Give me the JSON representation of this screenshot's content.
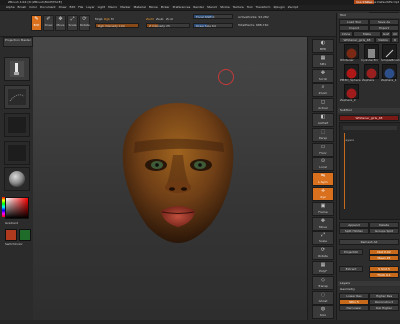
{
  "app": {
    "title": "ZBrush 4.R4  [D:\\ZBrush\\FACE\\FACE]",
    "quicksave": "QuickSave",
    "menus_label": "Menus",
    "default_script": "DefaultZScript"
  },
  "menu_bar": [
    "Alpha",
    "Brush",
    "Color",
    "Document",
    "Draw",
    "Edit",
    "File",
    "Layer",
    "Light",
    "Macro",
    "Marker",
    "Material",
    "Movie",
    "Picker",
    "Preferences",
    "Render",
    "Stencil",
    "Stroke",
    "Texture",
    "Tool",
    "Transform",
    "Zplugin",
    "Zscript"
  ],
  "shelf": {
    "tools": [
      {
        "label": "Edit",
        "icon": "pencil-icon",
        "glyph": "✎"
      },
      {
        "label": "Draw",
        "icon": "brush-icon",
        "glyph": "✐"
      },
      {
        "label": "Move",
        "icon": "move-icon",
        "glyph": "✥"
      },
      {
        "label": "Scale",
        "icon": "scale-icon",
        "glyph": "⤢"
      },
      {
        "label": "Rotate",
        "icon": "rotate-icon",
        "glyph": "⟳"
      }
    ],
    "modes": {
      "mrgb": "Mrgb",
      "rgb": "Rgb",
      "m": "M",
      "zadd": "Zadd",
      "zsub": "Zsub",
      "zcut": "Zcut"
    },
    "sliders": {
      "rgb_intensity": {
        "label": "Rgb Intensity",
        "value": 100,
        "fraction": 1.0
      },
      "z_intensity": {
        "label": "Z Intensity",
        "value": 25,
        "fraction": 0.25
      },
      "focal_shift": {
        "label": "Focal Shift",
        "value": 0,
        "fraction": 0.5
      },
      "draw_size": {
        "label": "Draw Size",
        "value": 64,
        "fraction": 0.35
      }
    },
    "stats": {
      "active_points": "ActivePoints: 93,282",
      "total_points": "TotalPoints: 688,740"
    },
    "lightbox": "Light Box"
  },
  "left_shelf": {
    "projection_master": "Projection Master",
    "gradient_label": "Gradient",
    "switch_color_label": "SwitchColor",
    "colors": {
      "main": "#b03a1e",
      "secondary": "#1f6b2a",
      "secondary_b": "#c87a18"
    }
  },
  "right_toolbar": [
    {
      "label": "BPR",
      "icon": "bpr-icon",
      "glyph": "◐"
    },
    {
      "label": "SPix",
      "icon": "spix-icon",
      "glyph": "▦"
    },
    {
      "label": "Scroll",
      "icon": "scroll-icon",
      "glyph": "✥"
    },
    {
      "label": "Zoom",
      "icon": "zoom-icon",
      "glyph": "⌕"
    },
    {
      "label": "Actual",
      "icon": "actual-icon",
      "glyph": "◻"
    },
    {
      "label": "AAHalf",
      "icon": "aahalf-icon",
      "glyph": "◧"
    },
    {
      "label": "Persp",
      "icon": "persp-icon",
      "glyph": "⬚"
    },
    {
      "label": "Floor",
      "icon": "floor-icon",
      "glyph": "▭"
    },
    {
      "label": "Local",
      "icon": "local-icon",
      "glyph": "⊙"
    },
    {
      "label": "L.Sym",
      "icon": "lsym-icon",
      "glyph": "⇋"
    },
    {
      "label": "Xyz",
      "icon": "xyz-icon",
      "glyph": "✛"
    },
    {
      "label": "Frame",
      "icon": "frame-icon",
      "glyph": "▣"
    },
    {
      "label": "Move",
      "icon": "move-view-icon",
      "glyph": "✥"
    },
    {
      "label": "Scale",
      "icon": "scale-view-icon",
      "glyph": "⤢"
    },
    {
      "label": "Rotate",
      "icon": "rotate-view-icon",
      "glyph": "⟳"
    },
    {
      "label": "PolyF",
      "icon": "polyframe-icon",
      "glyph": "▦"
    },
    {
      "label": "Transp",
      "icon": "transp-icon",
      "glyph": "◇"
    },
    {
      "label": "Ghost",
      "icon": "ghost-icon",
      "glyph": "◌"
    },
    {
      "label": "Solo",
      "icon": "solo-icon",
      "glyph": "◍"
    }
  ],
  "palette": {
    "header": "Tool",
    "load_tool": "Load Tool",
    "save_as": "Save As",
    "import": "Import",
    "export": "Export",
    "clone": "Clone",
    "make_polymesh": "Make PolyMesh3D",
    "goz": "GoZ",
    "all": "All",
    "visible": "Visible",
    "r": "R",
    "current_tool": "Whitener_girls_48",
    "thumbs": [
      "Whitener",
      "Cylinder3D",
      "SimpleBrush",
      "PM3D_Sphere",
      "Zsphere",
      "Zsphere_1",
      "Zsphere_2"
    ],
    "subtool_head": "SubTool",
    "subtools": [
      "Whitener_girls_48"
    ],
    "layers_subhead": "Layers",
    "append": "Append",
    "delete": "Delete",
    "split_hidden": "Split Hidden",
    "groups_split": "Groups Split",
    "remesh_all": "Remesh All",
    "project_all": "ProjectAll",
    "dist": "Dist 0.02",
    "mean": "Mean 25",
    "extract": "Extract",
    "s_smt": "S Smt 5",
    "thick": "Thick 0.1",
    "layers_head": "Layers",
    "geometry_head": "Geometry",
    "lower_res": "Lower Res",
    "higher_res": "Higher Res",
    "sdiv": "SDiv 5",
    "reconstruct": "Reconstruct Subdiv",
    "del_lower": "Del Lower",
    "del_higher": "Del Higher"
  }
}
